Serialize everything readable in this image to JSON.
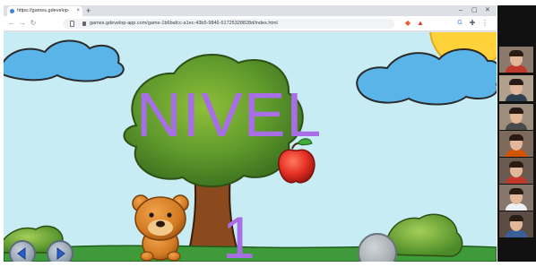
{
  "browser": {
    "tab_title": "https://games.gdevelop-app...",
    "tab_close": "×",
    "new_tab": "+",
    "url": "games.gdevelop-app.com/game-1b6bafcc-a1ec-43b5-9846-51725328828d/index.html",
    "window_controls": {
      "minimize": "–",
      "maximize": "▢",
      "close": "✕"
    }
  },
  "game": {
    "title": "NIVEL",
    "level": "1",
    "colors": {
      "sky": "#c8ecf3",
      "title_text": "#a86ee6",
      "grass": "#3f9b3a",
      "sun": "#ffd23a",
      "apple": "#e53025"
    },
    "controls": {
      "left_button": "left-arrow-icon",
      "right_button": "right-arrow-icon",
      "jump_button": "jump-button"
    }
  },
  "video_call": {
    "participant_count": 7,
    "tiles": [
      {
        "shirt": "#c0392b",
        "bg": "#8b7a6c"
      },
      {
        "shirt": "#2c3e50",
        "bg": "#b0a08d"
      },
      {
        "shirt": "#4a4a4a",
        "bg": "#9c8d7d"
      },
      {
        "shirt": "#d35400",
        "bg": "#7d6a5d"
      },
      {
        "shirt": "#c0392b",
        "bg": "#6a5a50"
      },
      {
        "shirt": "#ecf0f1",
        "bg": "#85776b"
      },
      {
        "shirt": "#3b5f9a",
        "bg": "#5b4d44"
      }
    ]
  }
}
